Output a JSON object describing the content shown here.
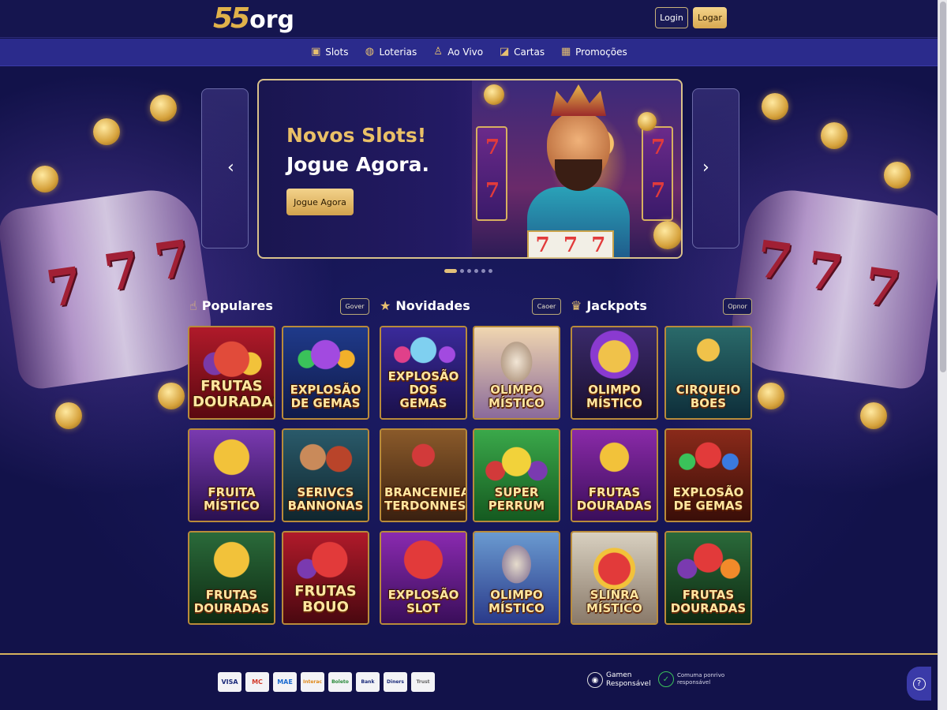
{
  "header": {
    "logo_number": "55",
    "logo_text": "org",
    "login_label": "Login",
    "register_label": "Logar"
  },
  "nav": {
    "items": [
      {
        "label": "Slots",
        "icon": "slot-machine-icon",
        "glyph": "▣"
      },
      {
        "label": "Loterias",
        "icon": "globe-icon",
        "glyph": "◍"
      },
      {
        "label": "Ao Vivo",
        "icon": "dealer-icon",
        "glyph": "♙"
      },
      {
        "label": "Cartas",
        "icon": "cards-icon",
        "glyph": "◪"
      },
      {
        "label": "Promoções",
        "icon": "gift-icon",
        "glyph": "▦"
      }
    ]
  },
  "hero": {
    "title_line1": "Novos Slots!",
    "title_line2": "Jogue Agora.",
    "button_label": "Jogue Agora",
    "slide_count": 6,
    "active_slide": 0
  },
  "sections": {
    "populares": {
      "title": "Populares",
      "see_label": "Gover",
      "icon": "thumbs-up-icon"
    },
    "novidades": {
      "title": "Novidades",
      "see_label": "Caoer",
      "icon": "star-icon"
    },
    "jackpots": {
      "title": "Jackpots",
      "see_label": "Opnor",
      "icon": "trophy-icon"
    }
  },
  "games": [
    [
      "FRUTAS\nDOURADAS",
      "EXPLOSÃO\nDE GEMAS",
      "EXPLOSÃO\nDOS GEMAS",
      "OLIMPO\nMÍSTICO",
      "OLIMPO\nMÍSTICO",
      "CIRQUEIO\nBOES"
    ],
    [
      "FRUITA\nMÍSTICO",
      "SERIVCS\nBANNONAS",
      "BRANCENIEA\nTERDONNES",
      "SUPER PERRUM",
      "FRUTAS\nDOURADAS",
      "EXPLOSÃO\nDE GEMAS"
    ],
    [
      "FRUTAS\nDOURADAS",
      "FRUTAS\nBOUO",
      "EXPLOSÃO\nSLOT",
      "OLIMPO\nMÍSTICO",
      "SLINRA MÍSTICO",
      "FRUTAS\nDOURADAS"
    ]
  ],
  "footer": {
    "payments": [
      "VISA",
      "MC",
      "MAE",
      "Interac",
      "Boleto",
      "Bank",
      "Diners",
      "Trust"
    ],
    "responsible_line1": "Gamen",
    "responsible_line2": "Responsável",
    "verified_line1": "Comuma ponrivo",
    "verified_line2": "responsável"
  },
  "colors": {
    "accent_gold": "#e0b24a",
    "nav_bg": "#2b2b8c",
    "page_bg": "#12124a"
  }
}
